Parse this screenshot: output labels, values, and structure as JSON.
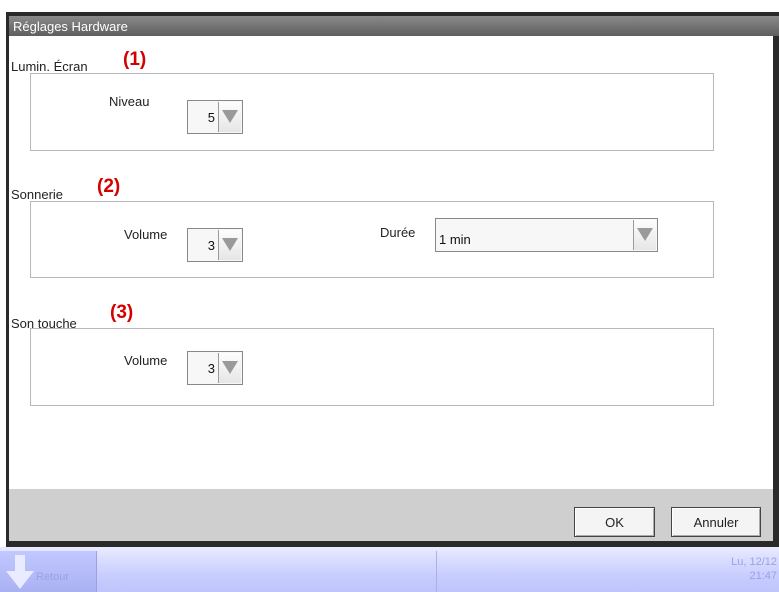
{
  "window": {
    "title": "Réglages Hardware"
  },
  "screen_brightness": {
    "label": "Lumin. Écran",
    "marker": "(1)",
    "level_label": "Niveau",
    "level_value": "5"
  },
  "ringtone": {
    "label": "Sonnerie",
    "marker": "(2)",
    "volume_label": "Volume",
    "volume_value": "3",
    "duration_label": "Durée",
    "duration_value": "1 min"
  },
  "key_sound": {
    "label": "Son touche",
    "marker": "(3)",
    "volume_label": "Volume",
    "volume_value": "3"
  },
  "buttons": {
    "ok": "OK",
    "cancel": "Annuler"
  },
  "taskbar": {
    "back_label": "Retour",
    "clock_date": "Lu, 12/12",
    "clock_time": "21:47"
  },
  "colors": {
    "marker": "#d40000",
    "titlebar": "#6e6e6e",
    "taskbar": "#c9ceff"
  },
  "icons": {
    "dropdown": "triangle-down-icon",
    "back": "arrow-down-icon"
  }
}
